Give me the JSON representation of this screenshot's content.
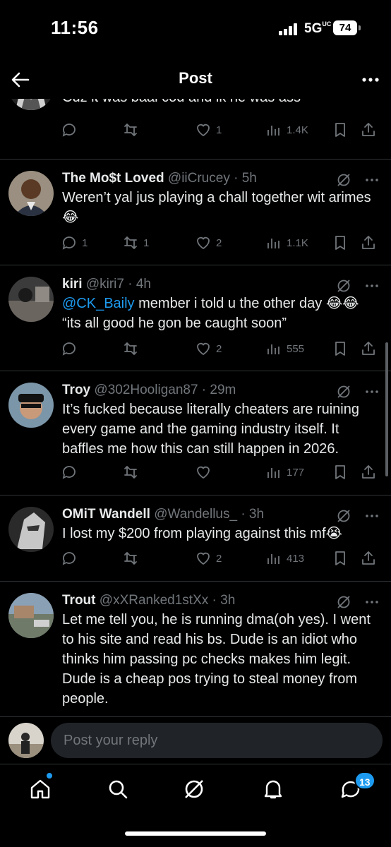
{
  "status_bar": {
    "time": "11:56",
    "network": "5G",
    "network_sub": "UC",
    "battery": "74"
  },
  "header": {
    "title": "Post"
  },
  "replies": [
    {
      "name": "",
      "handle": "",
      "text": "Cuz it was baal cod and ik he was ass",
      "replies": "",
      "reposts": "",
      "likes": "1",
      "views": "1.4K"
    },
    {
      "name": "The Mo$t Loved",
      "handle": "@iiCrucey · 5h",
      "text": "Weren’t yal jus playing a chall together wit arimes 😂",
      "replies": "1",
      "reposts": "1",
      "likes": "2",
      "views": "1.1K"
    },
    {
      "name": "kiri",
      "handle": "@kiri7 · 4h",
      "mention": "@CK_Baily",
      "text": " member i told u the other day 😂😂 “its all good he gon be caught soon”",
      "replies": "",
      "reposts": "",
      "likes": "2",
      "views": "555"
    },
    {
      "name": "Troy",
      "handle": "@302Hooligan87 · 29m",
      "text": "It’s fucked because literally cheaters are ruining every game and the gaming industry itself. It baffles me how this can still happen in 2026.",
      "replies": "",
      "reposts": "",
      "likes": "",
      "views": "177"
    },
    {
      "name": "OMiT Wandell",
      "handle": "@Wandellus_ · 3h",
      "text": "I lost my $200 from playing against this mf😭",
      "replies": "",
      "reposts": "",
      "likes": "2",
      "views": "413"
    },
    {
      "name": "Trout",
      "handle": "@xXRanked1stXx · 3h",
      "text": "Let me tell you, he is running dma(oh yes). I went to his site and read his bs. Dude is an idiot who thinks him passing pc checks makes him legit. Dude is a cheap pos trying to steal money from people.",
      "replies": "",
      "reposts": "",
      "likes": "",
      "views": ""
    }
  ],
  "reply_bar": {
    "placeholder": "Post your reply"
  },
  "nav": {
    "messages_badge": "13"
  },
  "icons": [
    "back-arrow-icon",
    "more-icon",
    "grok-icon",
    "reply-icon",
    "repost-icon",
    "like-icon",
    "views-icon",
    "bookmark-icon",
    "share-icon",
    "home-icon",
    "search-icon",
    "bell-icon",
    "messages-icon"
  ],
  "colors": {
    "background": "#000000",
    "text": "#e7e9ea",
    "muted": "#71767b",
    "accent": "#1d9bf0",
    "divider": "#2f3336"
  }
}
